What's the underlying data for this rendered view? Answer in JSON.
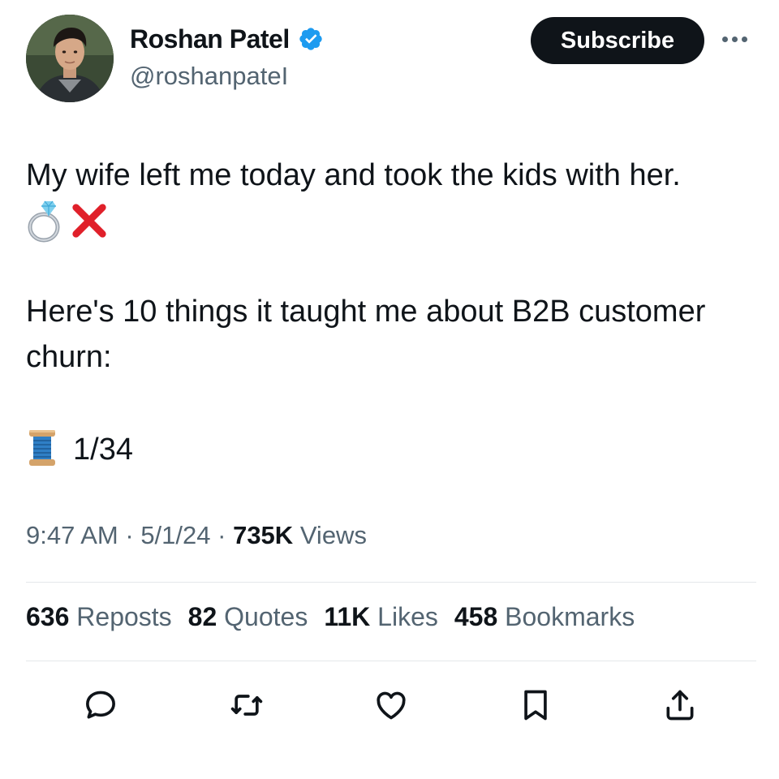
{
  "author": {
    "name": "Roshan Patel",
    "handle": "@roshanpateI",
    "avatar_icon": "avatar-photo",
    "verified_icon": "verified-badge-icon",
    "verified_color": "#1d9bf0"
  },
  "header": {
    "subscribe_label": "Subscribe",
    "more_icon": "more-options-icon"
  },
  "tweet": {
    "line1": "My wife left me today and took the kids with her.",
    "emojis": [
      "ring-emoji",
      "cross-mark-emoji"
    ],
    "line2": "Here's 10 things it taught me about B2B customer churn:",
    "thread_icon": "thread-spool-emoji",
    "thread_count": "1/34"
  },
  "meta": {
    "time": "9:47 AM",
    "date": "5/1/24",
    "views_count": "735K",
    "views_label": "Views",
    "separator": " · "
  },
  "stats": [
    {
      "count": "636",
      "label": "Reposts"
    },
    {
      "count": "82",
      "label": "Quotes"
    },
    {
      "count": "11K",
      "label": "Likes"
    },
    {
      "count": "458",
      "label": "Bookmarks"
    }
  ],
  "actions": [
    "reply-icon",
    "repost-icon",
    "like-icon",
    "bookmark-icon",
    "share-icon"
  ],
  "colors": {
    "text": "#0f1419",
    "secondary": "#536471",
    "button_bg": "#0f1419",
    "cross": "#e0202a"
  }
}
